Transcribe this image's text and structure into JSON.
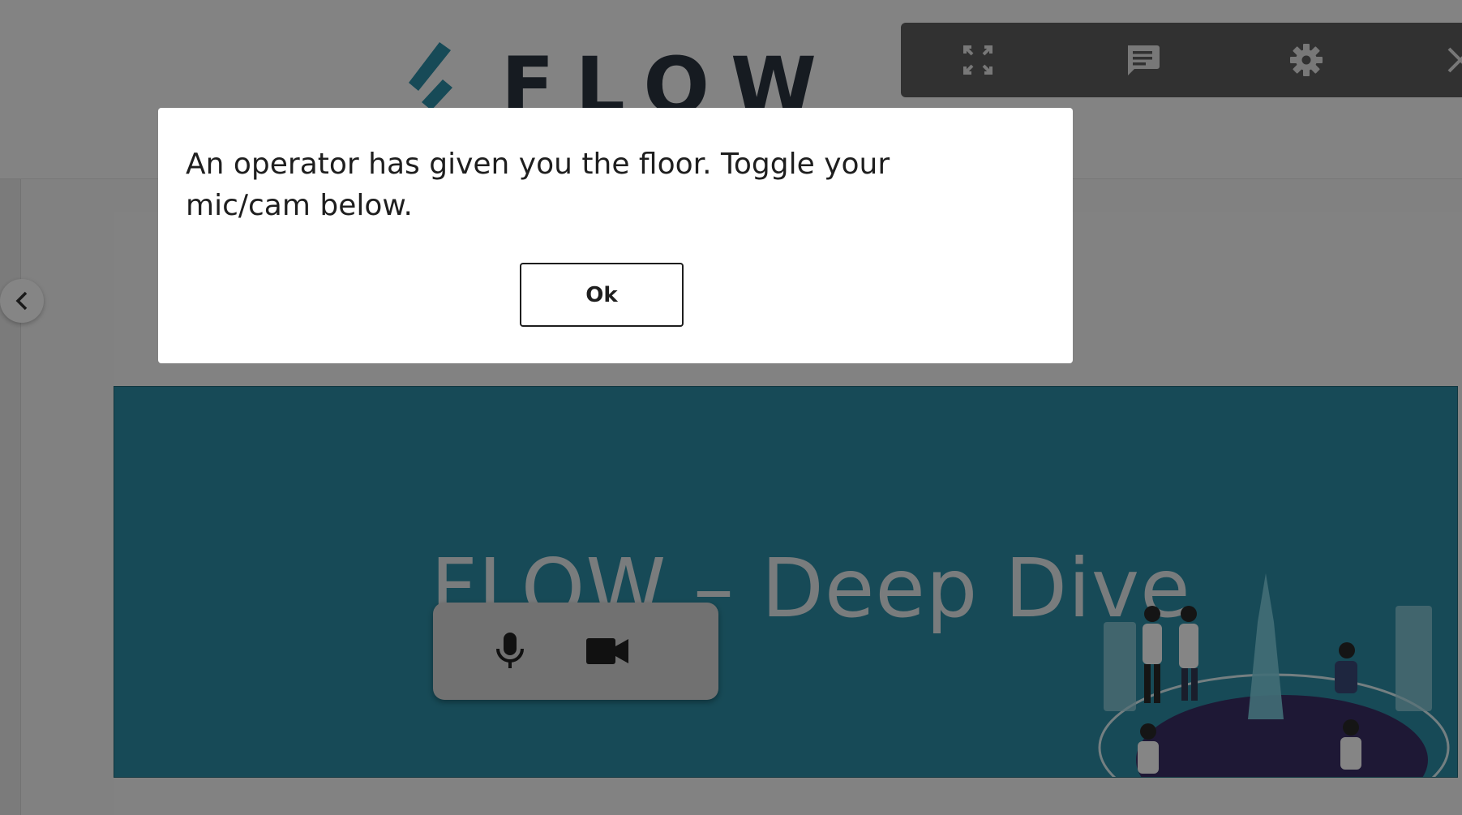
{
  "header": {
    "logo_text": "FLOW",
    "logo_color": "#2d8fa7"
  },
  "toolbar": {
    "icons": [
      "fullscreen-icon",
      "chat-icon",
      "gear-icon",
      "close-icon"
    ]
  },
  "sidebar": {
    "collapse_icon": "chevron-left-icon"
  },
  "slide": {
    "title": "FLOW – Deep Dive",
    "background_color": "#2d8fa7"
  },
  "media_controls": {
    "icons": [
      "microphone-icon",
      "camera-icon"
    ]
  },
  "modal": {
    "message": "An operator has given you the floor. Toggle your mic/cam below.",
    "ok_label": "Ok"
  }
}
